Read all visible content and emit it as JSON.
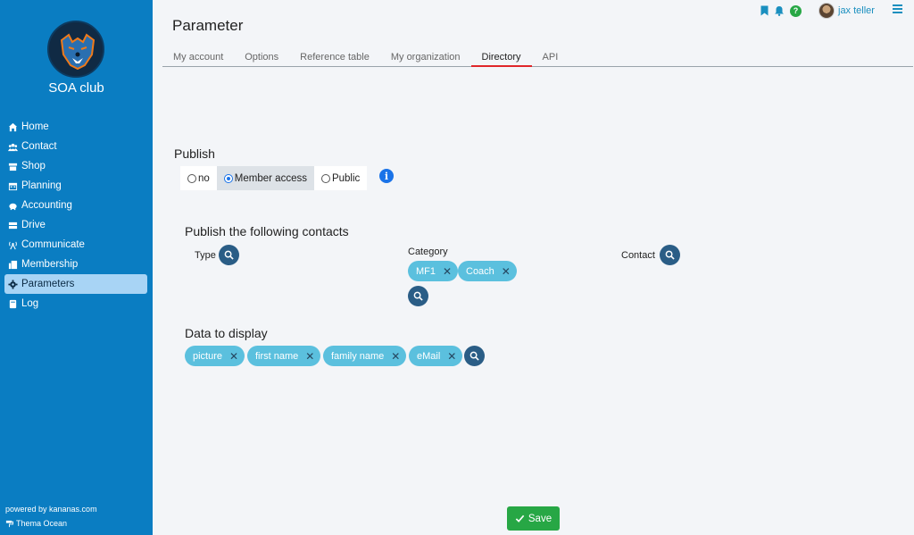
{
  "sidebar": {
    "club_name": "SOA club",
    "items": [
      {
        "label": "Home",
        "icon": "home-icon"
      },
      {
        "label": "Contact",
        "icon": "users-icon"
      },
      {
        "label": "Shop",
        "icon": "shop-icon"
      },
      {
        "label": "Planning",
        "icon": "calendar-icon"
      },
      {
        "label": "Accounting",
        "icon": "piggy-bank-icon"
      },
      {
        "label": "Drive",
        "icon": "drive-icon"
      },
      {
        "label": "Communicate",
        "icon": "broadcast-icon"
      },
      {
        "label": "Membership",
        "icon": "membership-icon"
      },
      {
        "label": "Parameters",
        "icon": "gear-icon",
        "active": true
      },
      {
        "label": "Log",
        "icon": "book-icon"
      }
    ],
    "powered_by": "powered by kananas.com",
    "theme": "Thema Ocean"
  },
  "header": {
    "title": "Parameter",
    "user_name": "jax teller",
    "help_label": "?"
  },
  "tabs": [
    {
      "label": "My account"
    },
    {
      "label": "Options"
    },
    {
      "label": "Reference table"
    },
    {
      "label": "My organization"
    },
    {
      "label": "Directory",
      "active": true
    },
    {
      "label": "API"
    }
  ],
  "publish": {
    "title": "Publish",
    "options": [
      {
        "label": "no",
        "selected": false
      },
      {
        "label": "Member access",
        "selected": true
      },
      {
        "label": "Public",
        "selected": false
      }
    ],
    "info_label": "i"
  },
  "contacts": {
    "title": "Publish the following contacts",
    "type_label": "Type",
    "category_label": "Category",
    "contact_label": "Contact",
    "categories": [
      "MF1",
      "Coach"
    ]
  },
  "display": {
    "title": "Data to display",
    "fields": [
      "picture",
      "first name",
      "family name",
      "eMail"
    ]
  },
  "save_label": "Save",
  "colors": {
    "sidebar": "#0a7dc2",
    "active_nav": "#a8d4f5",
    "chip": "#5bc0de",
    "search_button": "#2a5d86",
    "save": "#27a745",
    "active_tab_underline": "#e0262a"
  }
}
